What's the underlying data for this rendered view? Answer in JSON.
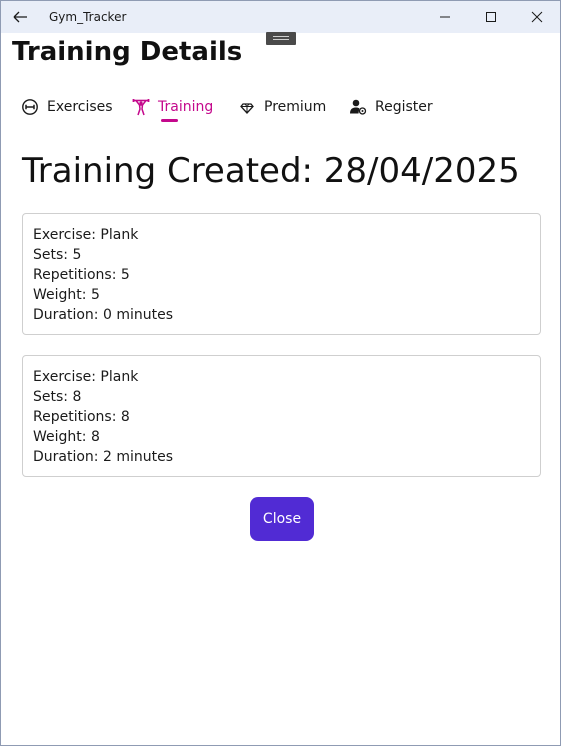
{
  "window": {
    "title": "Gym_Tracker"
  },
  "page": {
    "title": "Training Details"
  },
  "tabs": [
    {
      "label": "Exercises",
      "icon": "dumbbell-circle-icon",
      "selected": false
    },
    {
      "label": "Training",
      "icon": "weightlifter-icon",
      "selected": true
    },
    {
      "label": "Premium",
      "icon": "diamond-icon",
      "selected": false
    },
    {
      "label": "Register",
      "icon": "user-gear-icon",
      "selected": false
    }
  ],
  "content": {
    "heading": "Training Created: 28/04/2025",
    "entries": [
      {
        "exercise": "Exercise: Plank",
        "sets": "Sets: 5",
        "repetitions": "Repetitions: 5",
        "weight": "Weight: 5",
        "duration": "Duration: 0 minutes"
      },
      {
        "exercise": "Exercise: Plank",
        "sets": "Sets: 8",
        "repetitions": "Repetitions: 8",
        "weight": "Weight: 8",
        "duration": "Duration: 2 minutes"
      }
    ],
    "close_label": "Close"
  },
  "colors": {
    "accent": "#c4088c",
    "button": "#512bd4",
    "titlebar": "#e9eef8"
  }
}
